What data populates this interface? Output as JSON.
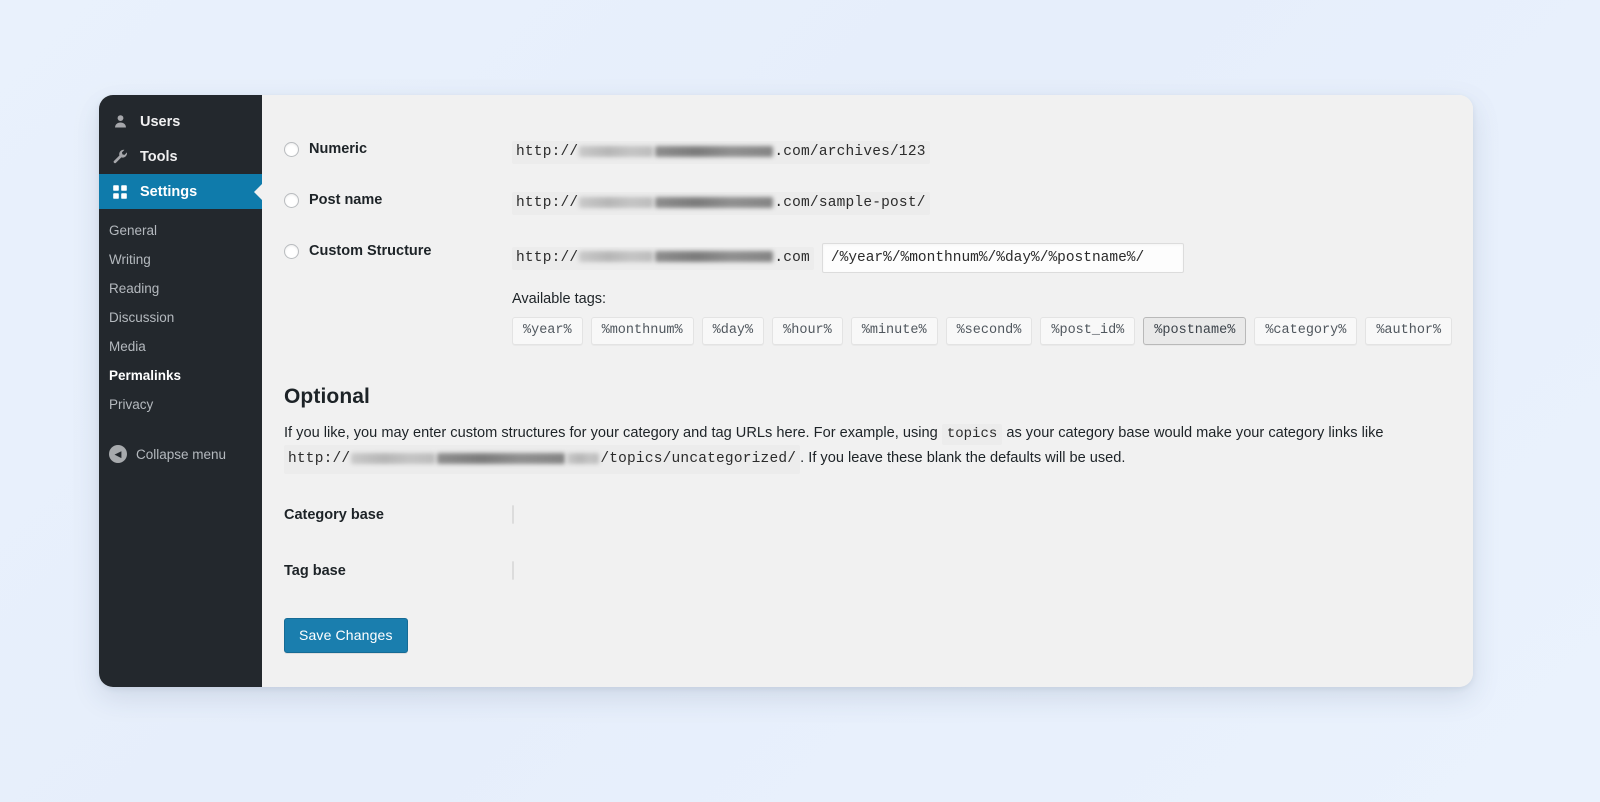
{
  "sidebar": {
    "top_items": [
      {
        "label": "Users",
        "icon": "users-icon",
        "current": false
      },
      {
        "label": "Tools",
        "icon": "wrench-icon",
        "current": false
      },
      {
        "label": "Settings",
        "icon": "settings-icon",
        "current": true
      }
    ],
    "submenu": [
      {
        "label": "General",
        "current": false
      },
      {
        "label": "Writing",
        "current": false
      },
      {
        "label": "Reading",
        "current": false
      },
      {
        "label": "Discussion",
        "current": false
      },
      {
        "label": "Media",
        "current": false
      },
      {
        "label": "Permalinks",
        "current": true
      },
      {
        "label": "Privacy",
        "current": false
      }
    ],
    "collapse_label": "Collapse menu",
    "collapse_icon": "chevron-left-circle-icon",
    "bg_color": "#23282d",
    "current_color": "#0f7bab"
  },
  "permalinks": {
    "options": [
      {
        "label": "Numeric",
        "selected": false,
        "url_prefix": "http://",
        "url_suffix": ".com/archives/123"
      },
      {
        "label": "Post name",
        "selected": false,
        "url_prefix": "http://",
        "url_suffix": ".com/sample-post/"
      },
      {
        "label": "Custom Structure",
        "selected": false,
        "url_prefix": "http://",
        "url_suffix": ".com",
        "value": "/%year%/%monthnum%/%day%/%postname%/"
      }
    ],
    "available_tags_label": "Available tags:",
    "tags": [
      {
        "label": "%year%",
        "active": false
      },
      {
        "label": "%monthnum%",
        "active": false
      },
      {
        "label": "%day%",
        "active": false
      },
      {
        "label": "%hour%",
        "active": false
      },
      {
        "label": "%minute%",
        "active": false
      },
      {
        "label": "%second%",
        "active": false
      },
      {
        "label": "%post_id%",
        "active": false
      },
      {
        "label": "%postname%",
        "active": true
      },
      {
        "label": "%category%",
        "active": false
      },
      {
        "label": "%author%",
        "active": false
      }
    ]
  },
  "optional": {
    "heading": "Optional",
    "desc_part1": "If you like, you may enter custom structures for your category and tag URLs here. For example, using",
    "code_topics": "topics",
    "desc_part2": "as your category base would make your category links like",
    "example_url_prefix": "http://",
    "example_url_suffix": "/topics/uncategorized/",
    "desc_part3": ". If you leave these blank the defaults will be used.",
    "category_base_label": "Category base",
    "category_base_value": "",
    "tag_base_label": "Tag base",
    "tag_base_value": ""
  },
  "actions": {
    "save_label": "Save Changes",
    "save_color": "#1a7eae"
  }
}
